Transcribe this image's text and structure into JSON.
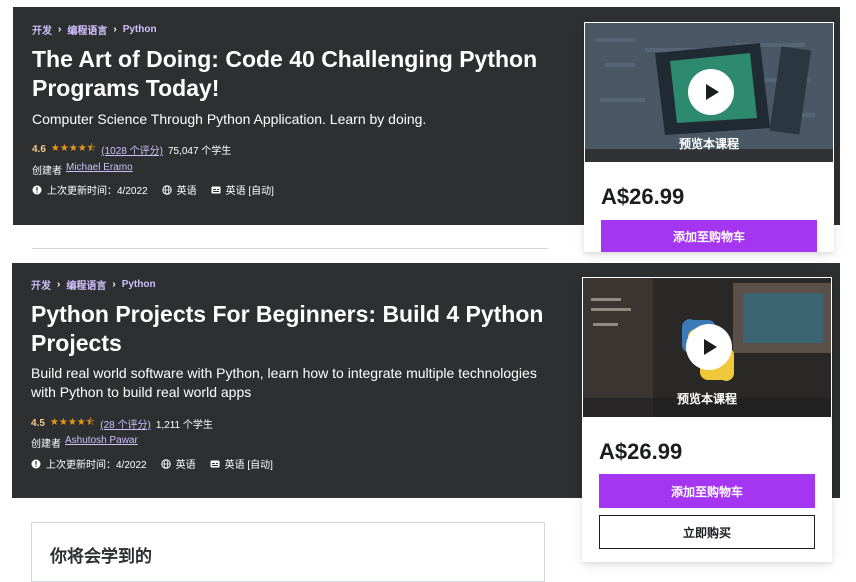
{
  "courses": [
    {
      "breadcrumbs": [
        "开发",
        "编程语言",
        "Python"
      ],
      "title": "The Art of Doing: Code 40 Challenging Python Programs Today!",
      "subtitle": "Computer Science Through Python Application. Learn by doing.",
      "rating": "4.6",
      "stars": "★★★★⯪",
      "rating_count": "(1028 个评分)",
      "students": "75,047 个学生",
      "created_by_label": "创建者",
      "instructor": "Michael Eramo",
      "last_updated": "上次更新时间：4/2022",
      "language": "英语",
      "captions": "英语 [自动]",
      "preview_label": "预览本课程",
      "price": "A$26.99",
      "add_to_cart": "添加至购物车"
    },
    {
      "breadcrumbs": [
        "开发",
        "编程语言",
        "Python"
      ],
      "title": "Python Projects For Beginners: Build 4 Python Projects",
      "subtitle": "Build real world software with Python, learn how to integrate multiple technologies with Python to build real world apps",
      "rating": "4.5",
      "stars": "★★★★⯪",
      "rating_count": "(28 个评分)",
      "students": "1,211 个学生",
      "created_by_label": "创建者",
      "instructor": "Ashutosh Pawar",
      "last_updated": "上次更新时间：4/2022",
      "language": "英语",
      "captions": "英语 [自动]",
      "preview_label": "预览本课程",
      "price": "A$26.99",
      "add_to_cart": "添加至购物车",
      "buy_now": "立即购买"
    }
  ],
  "learn_section": {
    "title": "你将会学到的"
  },
  "colors": {
    "hero_bg": "#2d2f31",
    "accent": "#a435f0",
    "link": "#cec0fc",
    "star": "#e59819"
  },
  "icons": [
    "chevron-right-icon",
    "star-icon",
    "alert-icon",
    "globe-icon",
    "captions-icon",
    "play-icon"
  ]
}
